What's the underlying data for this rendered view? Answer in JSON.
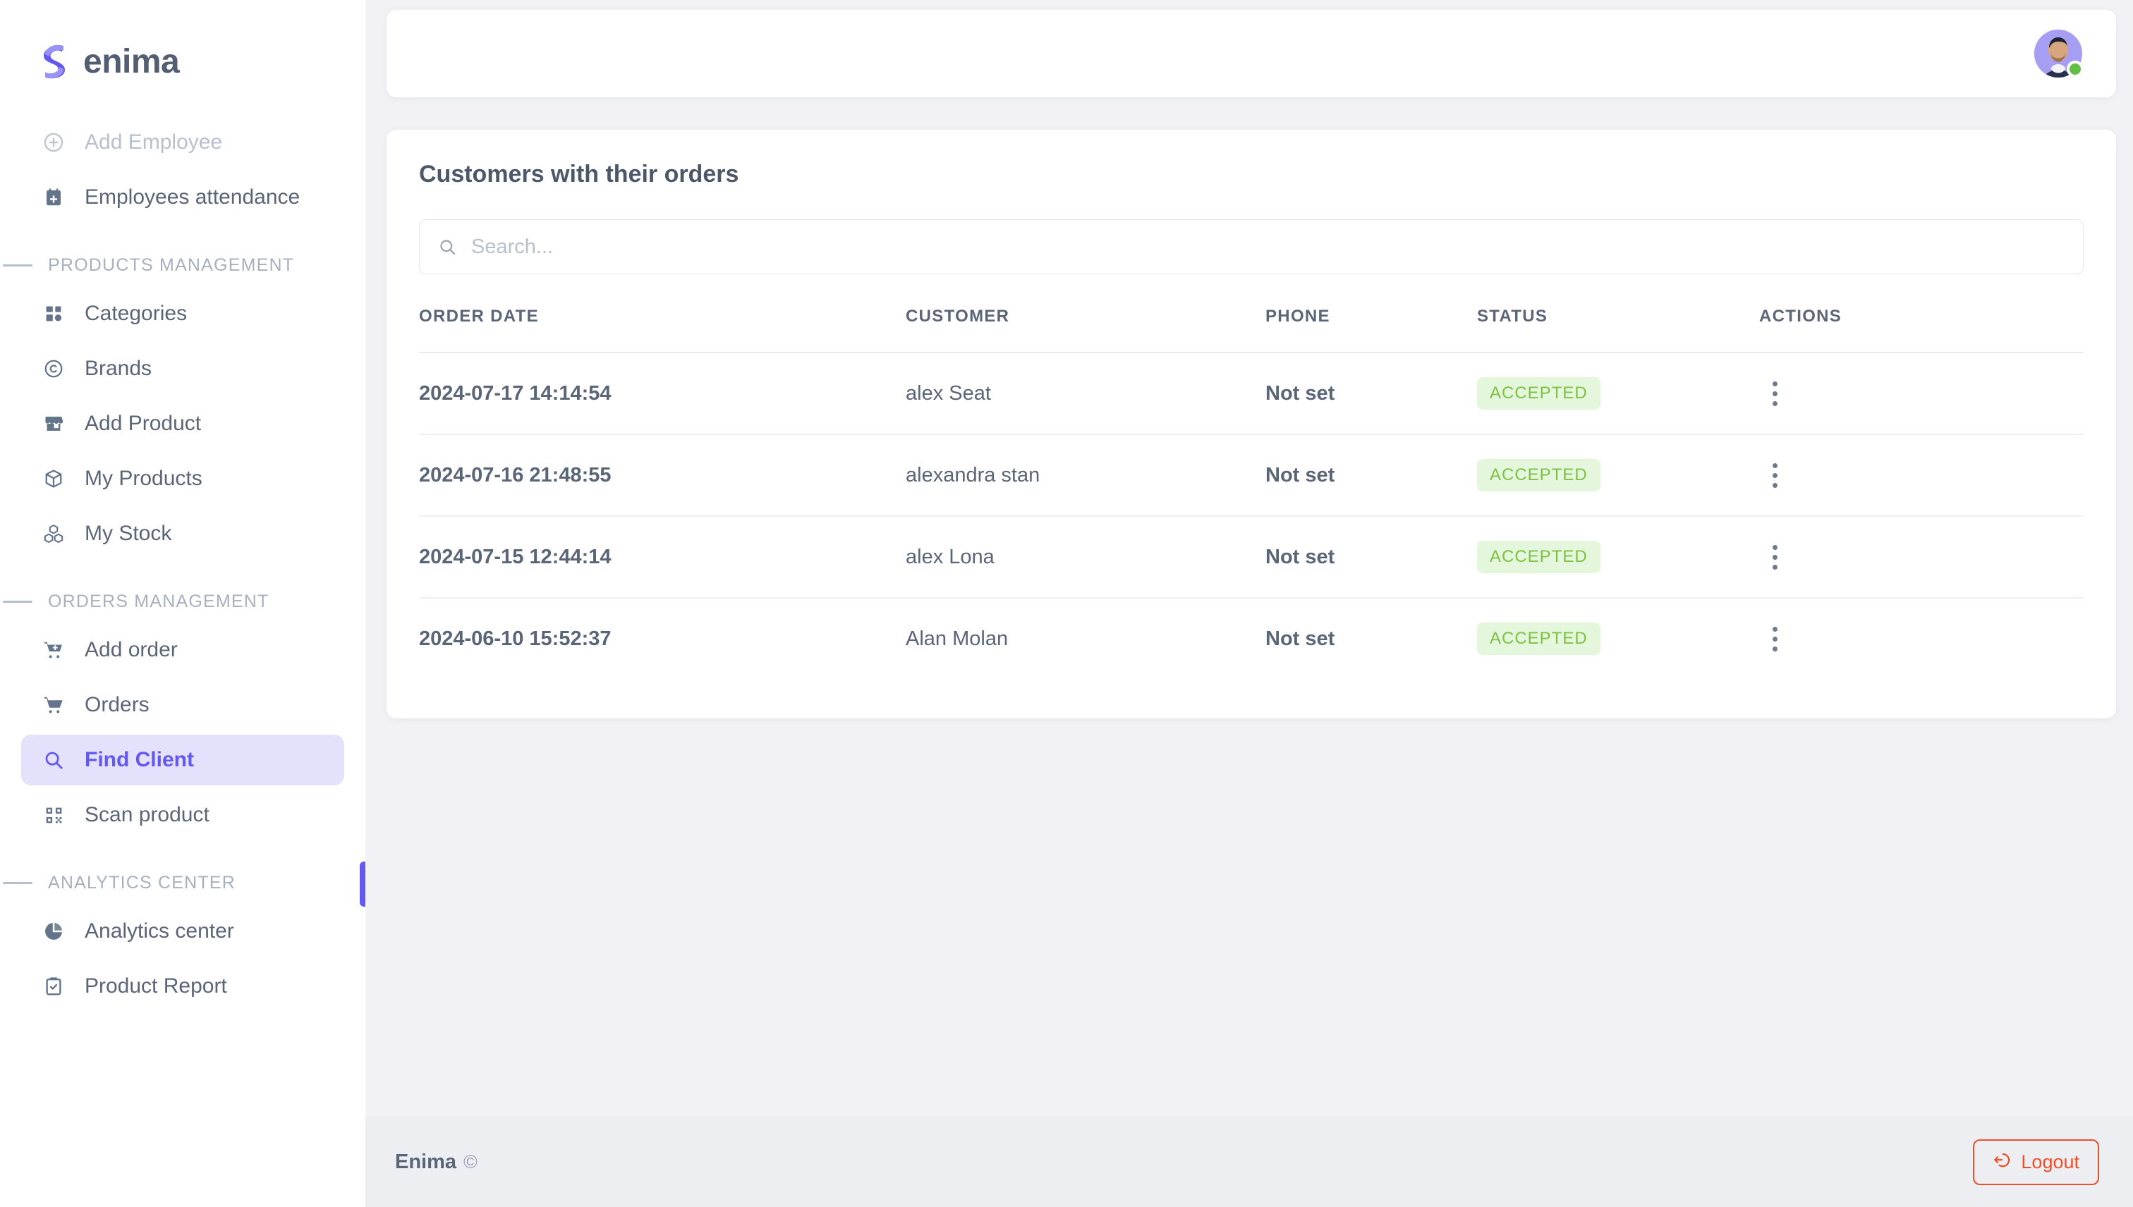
{
  "brand": {
    "name": "enima",
    "logo_icon": "enima-s-logo"
  },
  "sidebar": {
    "top_items": [
      {
        "label": "Add Employee",
        "icon": "plus-circle-icon",
        "muted": true
      },
      {
        "label": "Employees attendance",
        "icon": "calendar-plus-icon",
        "muted": false
      }
    ],
    "sections": [
      {
        "title": "PRODUCTS MANAGEMENT",
        "items": [
          {
            "label": "Categories",
            "icon": "grid-icon"
          },
          {
            "label": "Brands",
            "icon": "copyright-icon"
          },
          {
            "label": "Add Product",
            "icon": "store-icon"
          },
          {
            "label": "My Products",
            "icon": "box-icon"
          },
          {
            "label": "My Stock",
            "icon": "stack-boxes-icon"
          }
        ]
      },
      {
        "title": "ORDERS MANAGEMENT",
        "items": [
          {
            "label": "Add order",
            "icon": "cart-plus-icon"
          },
          {
            "label": "Orders",
            "icon": "cart-icon"
          },
          {
            "label": "Find Client",
            "icon": "search-icon",
            "active": true
          },
          {
            "label": "Scan product",
            "icon": "qr-code-icon"
          }
        ]
      },
      {
        "title": "ANALYTICS CENTER",
        "items": [
          {
            "label": "Analytics center",
            "icon": "pie-chart-icon"
          },
          {
            "label": "Product Report",
            "icon": "clipboard-check-icon"
          }
        ]
      }
    ]
  },
  "topbar": {
    "avatar_icon": "user-avatar",
    "status": "online"
  },
  "main": {
    "title": "Customers with their orders",
    "search": {
      "placeholder": "Search...",
      "value": "",
      "icon": "search-icon"
    },
    "table": {
      "columns": [
        "ORDER DATE",
        "CUSTOMER",
        "PHONE",
        "STATUS",
        "ACTIONS"
      ],
      "rows": [
        {
          "date": "2024-07-17 14:14:54",
          "customer": "alex Seat",
          "phone": "Not set",
          "status": "ACCEPTED",
          "actions_icon": "kebab-menu-icon"
        },
        {
          "date": "2024-07-16 21:48:55",
          "customer": "alexandra stan",
          "phone": "Not set",
          "status": "ACCEPTED",
          "actions_icon": "kebab-menu-icon"
        },
        {
          "date": "2024-07-15 12:44:14",
          "customer": "alex Lona",
          "phone": "Not set",
          "status": "ACCEPTED",
          "actions_icon": "kebab-menu-icon"
        },
        {
          "date": "2024-06-10 15:52:37",
          "customer": "Alan Molan",
          "phone": "Not set",
          "status": "ACCEPTED",
          "actions_icon": "kebab-menu-icon"
        }
      ]
    }
  },
  "footer": {
    "brand": "Enima",
    "copyright_mark": "©",
    "logout_label": "Logout",
    "logout_icon": "logout-icon"
  },
  "colors": {
    "accent": "#6358f0",
    "accent_bg": "#e3e1fc",
    "page_bg": "#f2f2f6",
    "text": "#5b6578",
    "muted": "#b9c0cd",
    "status_green_text": "#7dc242",
    "status_green_bg": "#e4f6dc",
    "logout_orange": "#f04e28",
    "online_green": "#62c044"
  }
}
